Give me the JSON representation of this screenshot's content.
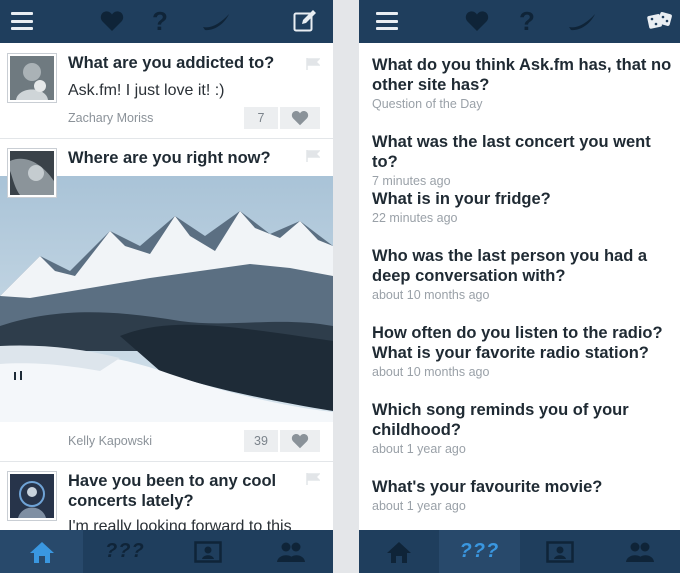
{
  "left": {
    "bottom_nav": {
      "home": "home-icon",
      "questions_label": "???",
      "profile": "profile-card-icon",
      "friends": "friends-icon"
    },
    "feed": [
      {
        "question": "What are you addicted to?",
        "answer": "Ask.fm! I just love it! :)",
        "author": "Zachary Moriss",
        "likes": "7"
      },
      {
        "question": "Where are you right now?",
        "author": "Kelly Kapowski",
        "likes": "39"
      },
      {
        "question": "Have you been to any cool concerts lately?",
        "answer": "I'm really looking forward to this"
      }
    ]
  },
  "right": {
    "bottom_nav": {
      "home": "home-icon",
      "questions_label": "???",
      "profile": "profile-card-icon",
      "friends": "friends-icon"
    },
    "questions": [
      {
        "text": "What do you think Ask.fm has, that no other site has?",
        "time": "Question of the Day"
      },
      {
        "text": "What was the last concert you went to?",
        "time": "7 minutes ago"
      },
      {
        "text": "What is in your fridge?",
        "time": "22 minutes ago"
      },
      {
        "text": "Who was the last person you had a deep conversation with?",
        "time": "about 10 months ago"
      },
      {
        "text": "How often do you listen to the radio? What is your favorite radio station?",
        "time": "about 10 months ago"
      },
      {
        "text": "Which song reminds you of your childhood?",
        "time": "about 1 year ago"
      },
      {
        "text": "What's your favourite movie?",
        "time": "about 1 year ago"
      }
    ]
  },
  "colors": {
    "bar": "#1f3e5d",
    "active_tab": "#28496b",
    "accent": "#3a97e0"
  }
}
